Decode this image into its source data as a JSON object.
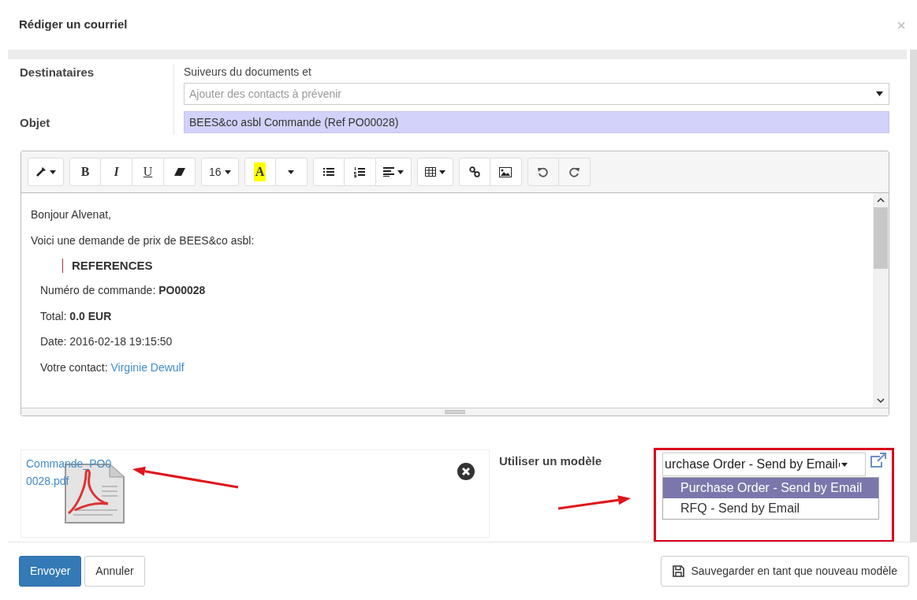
{
  "dialog": {
    "title": "Rédiger un courriel",
    "close": "×"
  },
  "form": {
    "recipients": {
      "label": "Destinataires",
      "note": "Suiveurs du documents et",
      "placeholder": "Ajouter des contacts à prévenir"
    },
    "subject": {
      "label": "Objet",
      "value": "BEES&co asbl Commande (Ref PO00028)"
    }
  },
  "toolbar": [
    {
      "buttons": [
        {
          "kind": "style",
          "dropdown": true
        }
      ]
    },
    {
      "buttons": [
        {
          "kind": "bold",
          "label": "B"
        },
        {
          "kind": "italic",
          "label": "I"
        },
        {
          "kind": "underline",
          "label": "U"
        },
        {
          "kind": "eraser"
        }
      ]
    },
    {
      "buttons": [
        {
          "kind": "size",
          "label": "16",
          "dropdown": true
        }
      ]
    },
    {
      "buttons": [
        {
          "kind": "color",
          "label": "A"
        },
        {
          "kind": "caret",
          "dropdown": true
        }
      ]
    },
    {
      "buttons": [
        {
          "kind": "bullets"
        },
        {
          "kind": "numbers"
        },
        {
          "kind": "align",
          "dropdown": true
        }
      ]
    },
    {
      "buttons": [
        {
          "kind": "table",
          "dropdown": true
        }
      ]
    },
    {
      "buttons": [
        {
          "kind": "link"
        },
        {
          "kind": "image"
        }
      ]
    },
    {
      "buttons": [
        {
          "kind": "undo"
        },
        {
          "kind": "redo"
        }
      ]
    }
  ],
  "body": [
    {
      "kind": "text",
      "text": "Bonjour Alvenat,"
    },
    {
      "kind": "text",
      "text": "Voici une demande de prix de BEES&co asbl:"
    },
    {
      "kind": "heading",
      "text": "REFERENCES"
    },
    {
      "kind": "detail",
      "text": "Numéro de commande: **PO00028**"
    },
    {
      "kind": "detail",
      "text": "Total: **0.0 EUR**"
    },
    {
      "kind": "detail",
      "text": "Date: 2016-02-18 19:15:50"
    },
    {
      "kind": "contact",
      "text": "Votre contact:",
      "link": "Virginie Dewulf"
    }
  ],
  "attachment": {
    "name": "Commande_PO0 0028.pdf"
  },
  "template": {
    "label": "Utiliser un modèle",
    "value": "urchase Order - Send by Email",
    "options": [
      {
        "label": "Purchase Order - Send by Email",
        "selected": true
      },
      {
        "label": "RFQ - Send by Email",
        "selected": false
      }
    ]
  },
  "footer": {
    "send": "Envoyer",
    "cancel": "Annuler",
    "save_template": "Sauvegarder en tant que nouveau modèle"
  }
}
